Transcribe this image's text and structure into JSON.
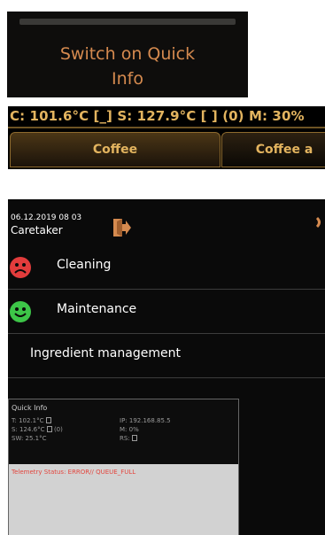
{
  "panel1": {
    "label_line1": "Switch on Quick",
    "label_line2": "Info"
  },
  "panel2": {
    "status_text": "C: 101.6°C [_] S: 127.9°C [ ] (0)  M: 30%",
    "tabs": [
      {
        "label": "Coffee"
      },
      {
        "label": "Coffee a"
      }
    ],
    "colors": {
      "accent": "#e3b45f"
    }
  },
  "panel3": {
    "datetime": "06.12.2019 08 03",
    "role": "Caretaker",
    "menu": [
      {
        "label": "Cleaning",
        "status": "red",
        "icon": "sad-face-icon"
      },
      {
        "label": "Maintenance",
        "status": "green",
        "icon": "happy-face-icon"
      },
      {
        "label": "Ingredient management"
      }
    ],
    "quick_info": {
      "title": "Quick Info",
      "t": "T: 102.1°C",
      "s": "S: 124.6°C",
      "s_count": "(0)",
      "sw": "SW: 25.1°C",
      "ip": "IP: 192.168.85.5",
      "m": "M: 0%",
      "rs": "RS:",
      "telemetry": "Telemetry Status: ERROR// QUEUE_FULL"
    },
    "colors": {
      "sad": "#e23c3c",
      "happy": "#3dc548",
      "telemetry": "#e3463e"
    }
  }
}
